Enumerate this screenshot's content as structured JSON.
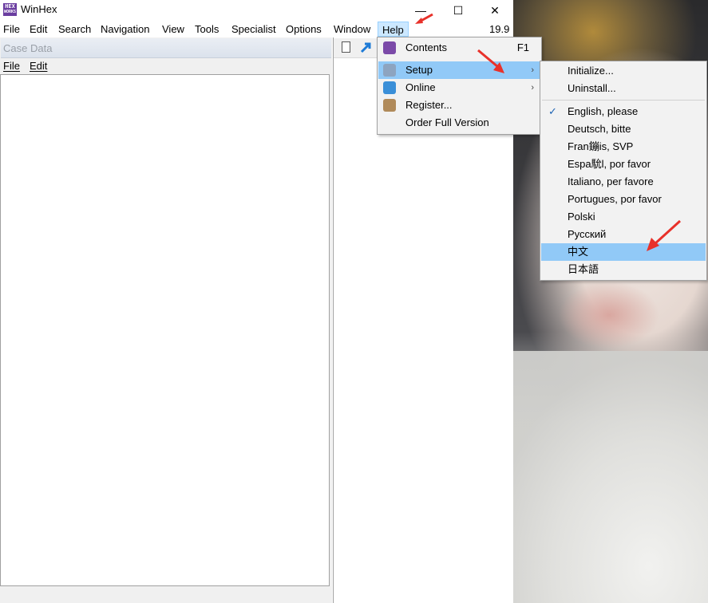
{
  "window": {
    "title": "WinHex",
    "logo_text_top": "HEX",
    "logo_text_bottom": "WORKS",
    "minimize_glyph": "—",
    "maximize_glyph": "☐",
    "close_glyph": "✕"
  },
  "menubar": {
    "items": [
      "File",
      "Edit",
      "Search",
      "Navigation",
      "View",
      "Tools",
      "Specialist",
      "Options",
      "Window",
      "Help"
    ],
    "version": "19.9"
  },
  "case_panel": {
    "title": "Case Data",
    "menu_file": "File",
    "menu_edit": "Edit"
  },
  "help_menu": {
    "items": [
      {
        "label": "Contents",
        "shortcut": "F1",
        "icon": "book-icon"
      },
      {
        "label": "Setup",
        "submenu": true,
        "icon": "setup-icon"
      },
      {
        "label": "Online",
        "submenu": true,
        "icon": "online-icon"
      },
      {
        "label": "Register...",
        "icon": "register-icon"
      },
      {
        "label": "Order Full Version"
      }
    ]
  },
  "setup_menu": {
    "items": [
      "Initialize...",
      "Uninstall...",
      "English, please",
      "Deutsch, bitte",
      "Fran鏰is, SVP",
      "Espa馻l, por favor",
      "Italiano, per favore",
      "Portugues, por favor",
      "Polski",
      "Русский",
      "中文",
      "日本語"
    ],
    "checked": "English, please",
    "highlighted": "中文"
  },
  "colors": {
    "highlight": "#91c9f7",
    "menu_bg": "#f2f2f2",
    "annotation": "#e8312a"
  }
}
